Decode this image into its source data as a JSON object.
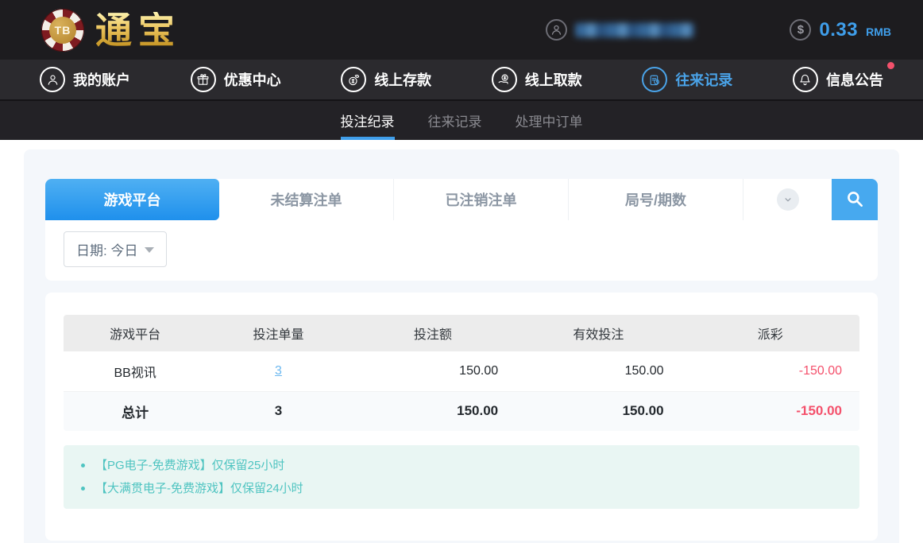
{
  "header": {
    "logo_tb": "TB",
    "logo_text": "通宝",
    "balance": "0.33",
    "currency": "RMB"
  },
  "nav": {
    "items": [
      {
        "label": "我的账户",
        "icon": "user",
        "active": false
      },
      {
        "label": "优惠中心",
        "icon": "gift",
        "active": false
      },
      {
        "label": "线上存款",
        "icon": "deposit",
        "active": false
      },
      {
        "label": "线上取款",
        "icon": "withdraw",
        "active": false
      },
      {
        "label": "往来记录",
        "icon": "records",
        "active": true
      },
      {
        "label": "信息公告",
        "icon": "bell",
        "active": false,
        "badge": true
      }
    ]
  },
  "subnav": {
    "tabs": [
      {
        "label": "投注纪录",
        "active": true
      },
      {
        "label": "往来记录",
        "active": false
      },
      {
        "label": "处理中订单",
        "active": false
      }
    ]
  },
  "filter_tabs": {
    "tabs": [
      "游戏平台",
      "未结算注单",
      "已注销注单",
      "局号/期数"
    ],
    "active_index": 0
  },
  "date_filter": {
    "label": "日期: 今日"
  },
  "table": {
    "headers": [
      "游戏平台",
      "投注单量",
      "投注额",
      "有效投注",
      "派彩"
    ],
    "rows": [
      {
        "platform": "BB视讯",
        "count": "3",
        "bet": "150.00",
        "valid": "150.00",
        "payout": "-150.00"
      }
    ],
    "total": {
      "platform": "总计",
      "count": "3",
      "bet": "150.00",
      "valid": "150.00",
      "payout": "-150.00"
    }
  },
  "notes": {
    "items": [
      "【PG电子-免费游戏】仅保留25小时",
      "【大满贯电子-免费游戏】仅保留24小时"
    ]
  },
  "colors": {
    "accent_blue": "#3f9eea",
    "tab_gradient_top": "#4fb0f3",
    "tab_gradient_bottom": "#1f90ec",
    "negative_red": "#f4516c",
    "note_teal": "#4fc4c1",
    "header_dark": "#1d1c1f",
    "nav_dark": "#2b2a2e"
  }
}
